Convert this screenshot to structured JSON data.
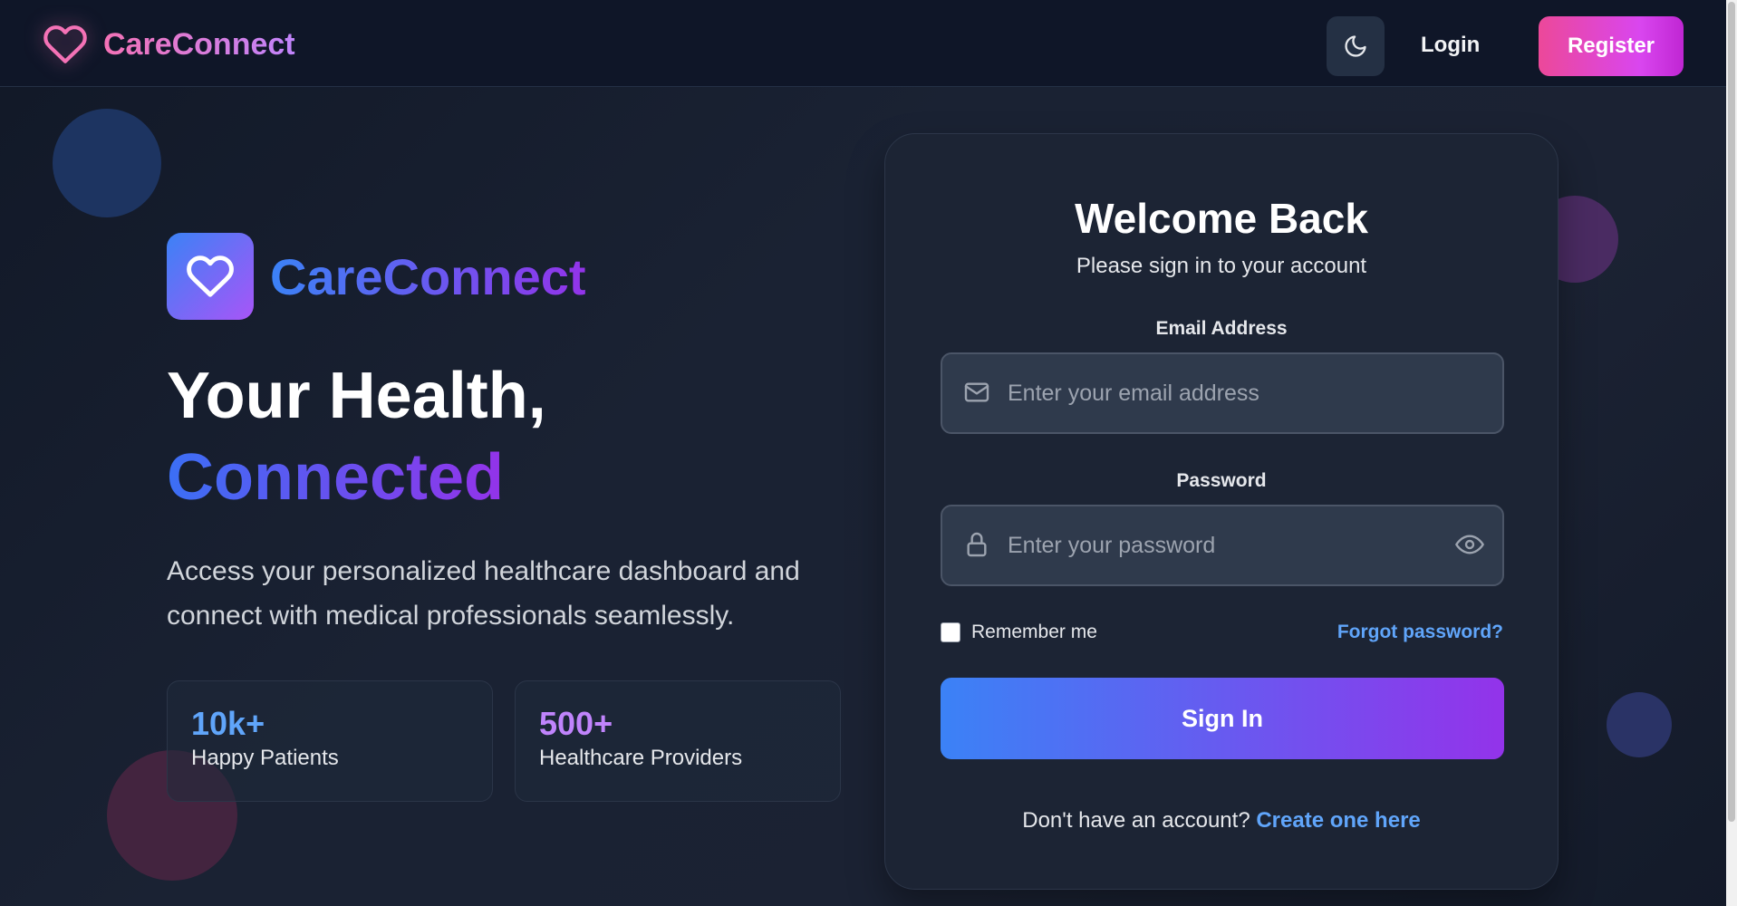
{
  "header": {
    "brand": "CareConnect",
    "login": "Login",
    "register": "Register",
    "theme_icon": "moon-icon"
  },
  "hero": {
    "brand": "CareConnect",
    "title_line1": "Your Health,",
    "title_line2": "Connected",
    "description": "Access your personalized healthcare dashboard and connect with medical professionals seamlessly.",
    "stats": [
      {
        "value": "10k+",
        "label": "Happy Patients"
      },
      {
        "value": "500+",
        "label": "Healthcare Providers"
      }
    ]
  },
  "login_form": {
    "title": "Welcome Back",
    "subtitle": "Please sign in to your account",
    "email_label": "Email Address",
    "email_placeholder": "Enter your email address",
    "email_value": "",
    "password_label": "Password",
    "password_placeholder": "Enter your password",
    "password_value": "",
    "remember_label": "Remember me",
    "remember_checked": false,
    "forgot": "Forgot password?",
    "submit": "Sign In",
    "signup_prompt": "Don't have an account?",
    "signup_link": "Create one here"
  },
  "colors": {
    "accent_pink": "#ec4899",
    "accent_blue": "#3b82f6",
    "accent_purple": "#9333ea",
    "link": "#60a5fa",
    "background": "#141b2b"
  }
}
